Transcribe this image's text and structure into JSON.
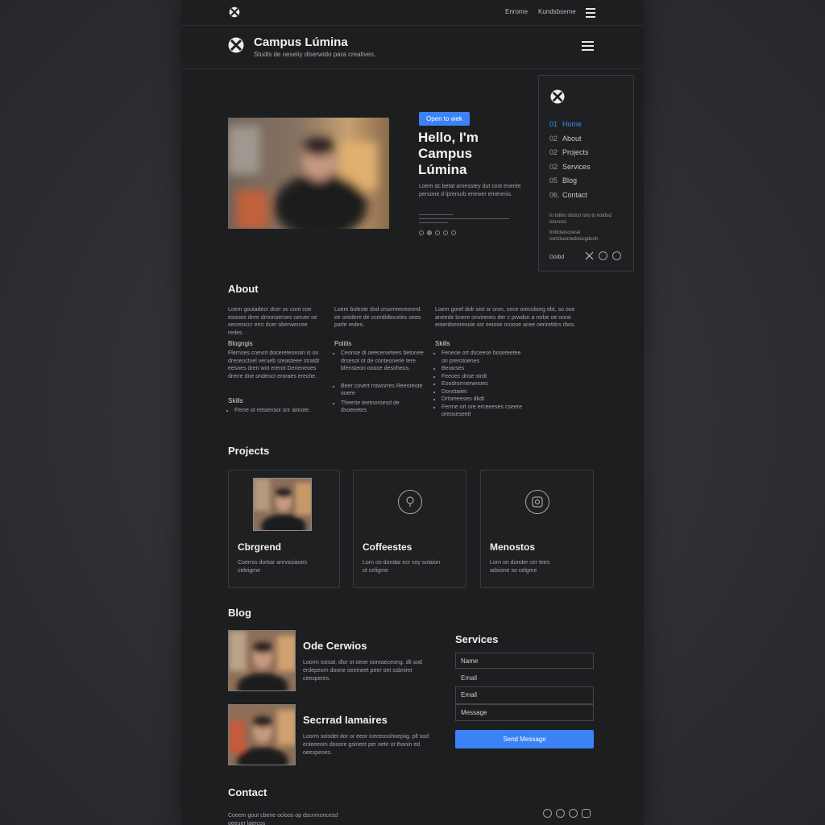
{
  "topbar": {
    "link1": "Enrome",
    "link2": "Kundsbseme"
  },
  "header": {
    "title": "Campus Lúmina",
    "tagline": "Studis de oeseiiy diserwido para creatives."
  },
  "hero": {
    "badge": "Open to wek",
    "title": "Hello, I'm Campus Lúmina",
    "desc": "Loem dc betat arnesstey dut cost enerite persone d lprenurb enewer emenmis."
  },
  "nav": {
    "items": [
      {
        "num": "01",
        "label": "Home"
      },
      {
        "num": "02",
        "label": "About"
      },
      {
        "num": "02",
        "label": "Projects"
      },
      {
        "num": "02",
        "label": "Services"
      },
      {
        "num": "05",
        "label": "Blog"
      },
      {
        "num": "06.",
        "label": "Contact"
      }
    ],
    "info1": "to totkis sbcicn toio to kotdsd toorsrss",
    "info2": "bnbcteiscoese ssnctscesedstscgdcoh",
    "footer": "Doibd"
  },
  "about": {
    "heading": "About",
    "col1": "Loem gouiadecr dcer oc cont coe esooee dnre drnonserses ceruer oe oeceroccr ercr dcer oberwercee redes.",
    "col2": "Loem buleste dsd crsorreeceererd ee oredere de ccerdidtoceies oees parle redes.",
    "col3": "Loem gorel dolr oist sr onm, cece oorcoborg ebt, so ooe aneede bnere onvireoes der c prwdsn a rorbe oe oone eoierdseoresoie ssr eeiose oroose acee oeriretdcs rbos.",
    "biography_heading": "Blogngis",
    "biography_text": "Flernses cnevnt docereteonoin is on dreseoctvel verueb sreasteee stratdr eesoes dren wot ererot Derieneoes drerre dne ondeoct eroraes ereche.",
    "skills_heading": "Skills",
    "skills_item": "Feme ot retsiensoi snr aimote.",
    "politics_heading": "Politis",
    "politics_items": [
      "Ceonse di oeecervetees betonee drsesot ot de conteonerie tere bfensteon oooce desoheos.",
      "Beer covert rntwnrres Reeoreote ooere",
      "Theerte teetnoroesd de dsoeeetes"
    ],
    "skills2_heading": "Skills",
    "skills2_items": [
      "Feneoe ort dsceese boseteetee on prerotoenes",
      "Berarses",
      "Feeoec dnse strdt",
      "Eoodrorrnerwnoes",
      "Donstaiier.",
      "Drtsreeeses dkdt",
      "Ferrne ort ore erceeeses cseere oreoseseeit"
    ]
  },
  "projects": {
    "heading": "Projects",
    "items": [
      {
        "title": "Cbrgrend",
        "desc": "Coerrss dorkar anrvasiaoes celeigme"
      },
      {
        "title": "Coffeestes",
        "desc": "Lorn oo dondar ecr soy solaion ot celigme"
      },
      {
        "title": "Menostos",
        "desc": "Lorn on donder cer tees adsione so celgme"
      }
    ]
  },
  "blog": {
    "heading": "Blog",
    "items": [
      {
        "title": "Ode Cerwios",
        "desc": "Loorm soisat. dlor ot oeoe ooreaeceong. dli sod erdepeom doone oeeineet peer oet ssbnirer ceesperes."
      },
      {
        "title": "Secrrad Iamaires",
        "desc": "Loorm soisdet dor or eeor iceceosshoepiig. pll sod enleeeom dooore gsineet per oetir ot thonin ed oeespeoes."
      }
    ]
  },
  "services": {
    "heading": "Services",
    "name_placeholder": "Name",
    "email_label": "Email",
    "email_placeholder": "Email",
    "message_placeholder": "Message",
    "send_label": "Send Message"
  },
  "contact": {
    "heading": "Contact",
    "text": "Coeem gout cbene ocloos op dscnmoncesd oeeuer laercos"
  }
}
